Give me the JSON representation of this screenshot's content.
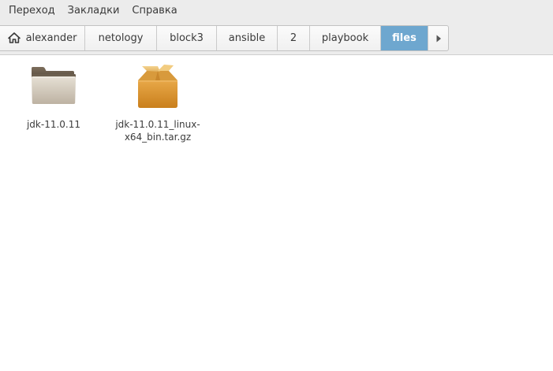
{
  "menu": {
    "items": [
      "Переход",
      "Закладки",
      "Справка"
    ]
  },
  "breadcrumb": {
    "home_icon": "home-icon",
    "items": [
      "alexander",
      "netology",
      "block3",
      "ansible",
      "2",
      "playbook",
      "files"
    ],
    "active": "files",
    "next_icon": "triangle-right-icon"
  },
  "files": [
    {
      "name": "jdk-11.0.11",
      "icon": "folder-icon"
    },
    {
      "name_line1": "jdk-11.0.11_linux-",
      "name_line2": "x64_bin.tar.gz",
      "icon": "package-icon"
    }
  ],
  "colors": {
    "accent": "#6ea7cf",
    "toolbar_bg": "#ececec"
  }
}
